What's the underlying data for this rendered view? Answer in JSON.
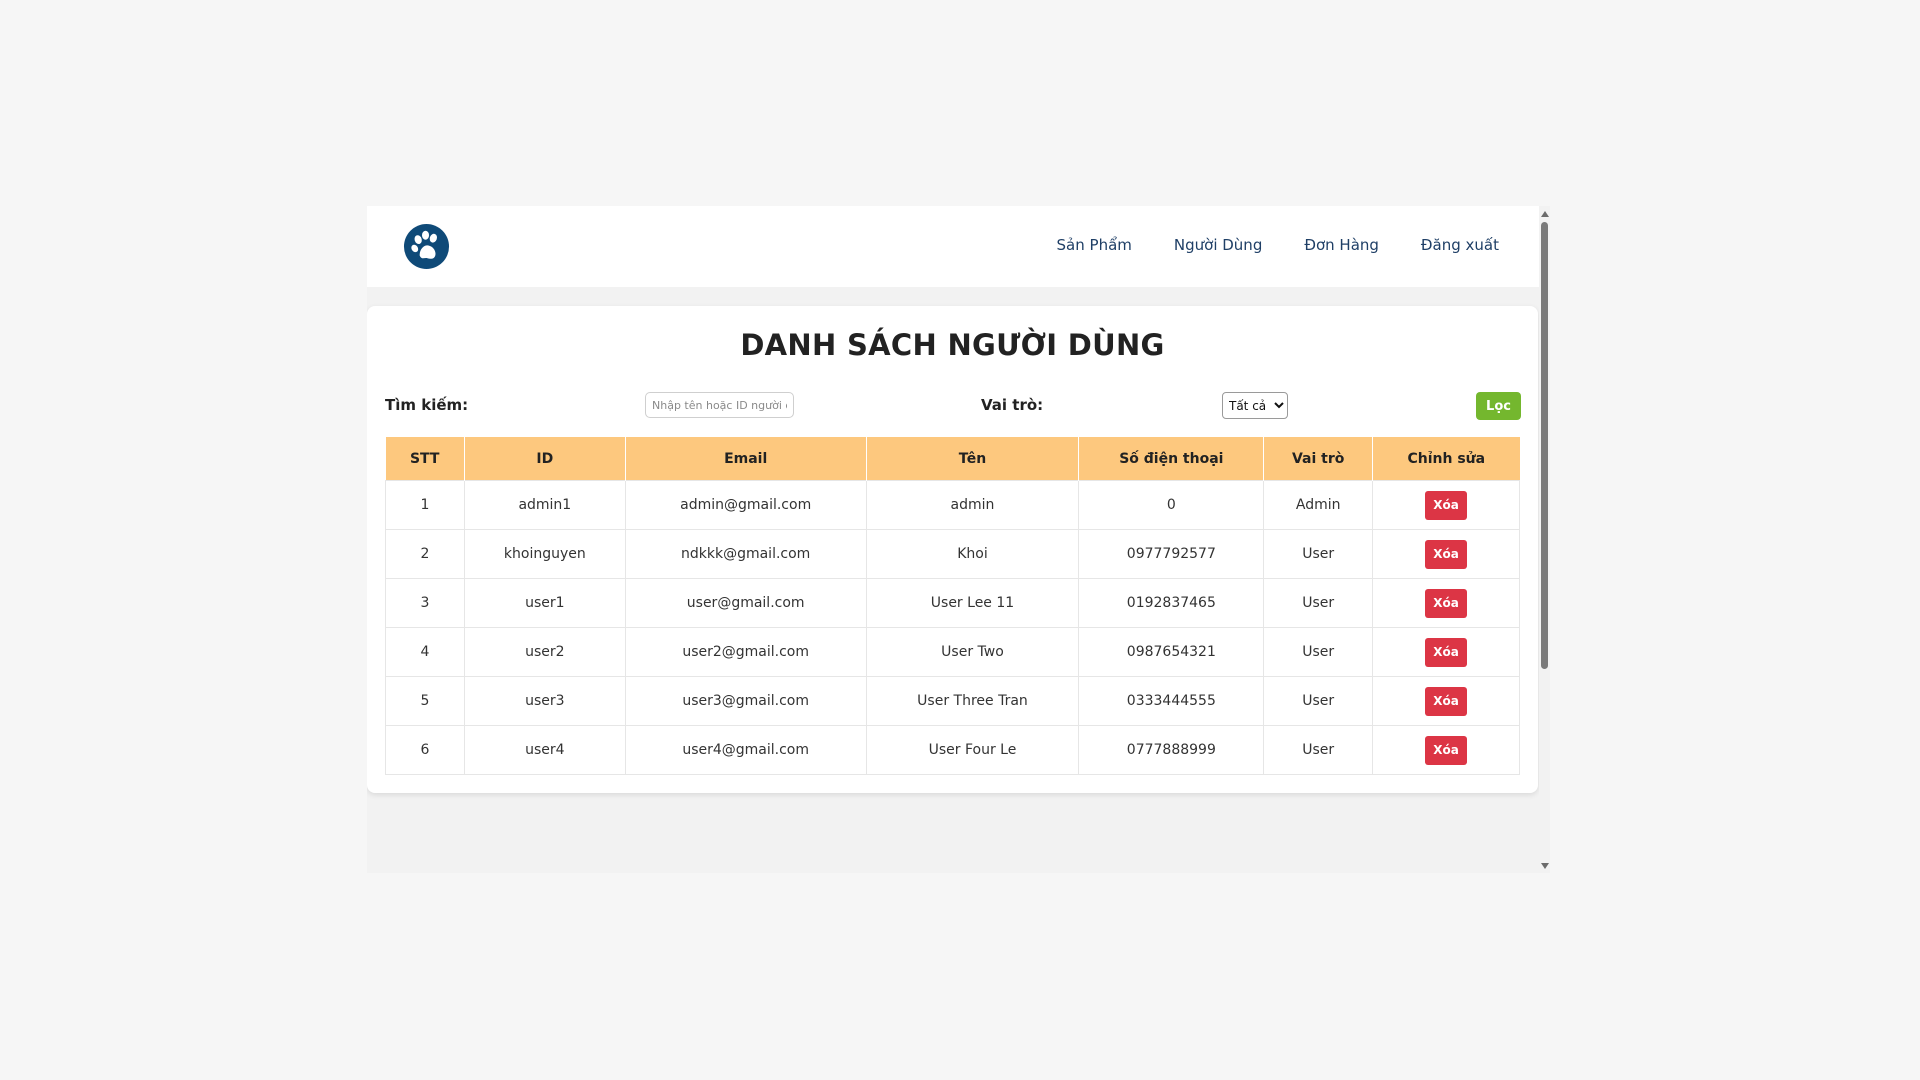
{
  "nav": {
    "items": [
      "Sản Phẩm",
      "Người Dùng",
      "Đơn Hàng",
      "Đăng xuất"
    ]
  },
  "logo": {
    "icon": "paw-icon",
    "color": "#0f4a78"
  },
  "page": {
    "title": "DANH SÁCH NGƯỜI DÙNG"
  },
  "filters": {
    "search_label": "Tìm kiếm:",
    "search_placeholder": "Nhập tên hoặc ID người dùng",
    "search_value": "",
    "role_label": "Vai trò:",
    "role_selected": "Tất cả",
    "filter_button": "Lọc"
  },
  "table": {
    "headers": [
      "STT",
      "ID",
      "Email",
      "Tên",
      "Số điện thoại",
      "Vai trò",
      "Chỉnh sửa"
    ],
    "delete_label": "Xóa",
    "rows": [
      {
        "stt": "1",
        "id": "admin1",
        "email": "admin@gmail.com",
        "name": "admin",
        "phone": "0",
        "role": "Admin"
      },
      {
        "stt": "2",
        "id": "khoinguyen",
        "email": "ndkkk@gmail.com",
        "name": "Khoi",
        "phone": "0977792577",
        "role": "User"
      },
      {
        "stt": "3",
        "id": "user1",
        "email": "user@gmail.com",
        "name": "User Lee 11",
        "phone": "0192837465",
        "role": "User"
      },
      {
        "stt": "4",
        "id": "user2",
        "email": "user2@gmail.com",
        "name": "User Two",
        "phone": "0987654321",
        "role": "User"
      },
      {
        "stt": "5",
        "id": "user3",
        "email": "user3@gmail.com",
        "name": "User Three Tran",
        "phone": "0333444555",
        "role": "User"
      },
      {
        "stt": "6",
        "id": "user4",
        "email": "user4@gmail.com",
        "name": "User Four Le",
        "phone": "0777888999",
        "role": "User"
      }
    ]
  },
  "colors": {
    "header_bg": "#fdc87e",
    "delete_button": "#dc3545",
    "filter_button": "#74b72e",
    "nav_text": "#1f3f66"
  }
}
